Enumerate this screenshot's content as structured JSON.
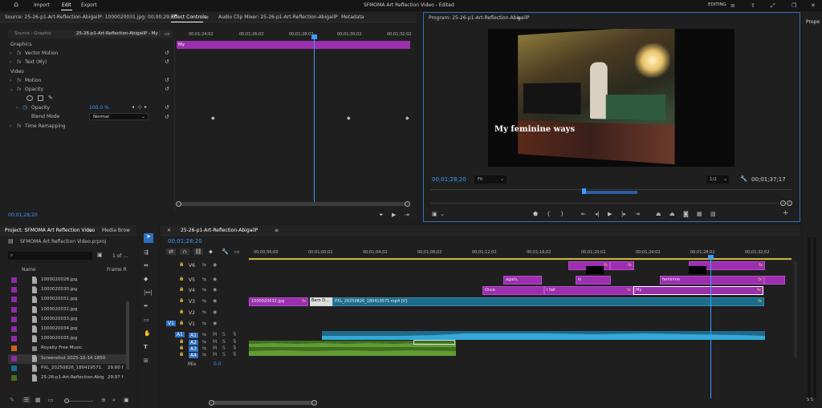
{
  "topbar": {
    "home": "home-icon",
    "menu": [
      "Import",
      "Edit",
      "Export"
    ],
    "active_menu": "Edit",
    "title": "SFMOMA Art Reflection Video - Edited",
    "workspace": "EDITING"
  },
  "source_panel": {
    "tabs": [
      "Source: 25-26-p1-Art-Reflection-AbigailP: 1000020031.jpg: 00;00;29;30",
      "Effect Controls",
      "Audio Clip Mixer: 25-26-p1-Art-Reflection-AbigailP",
      "Metadata"
    ],
    "active_tab": "Effect Controls"
  },
  "effect_controls": {
    "source_label": "Source - Graphic",
    "clip_label": "25-26-p1-Art-Reflection-AbigailP - My",
    "ruler": [
      "00;01;24;02",
      "00;01;26;02",
      "00;01;28;02",
      "00;01;30;02",
      "00;01;32;02"
    ],
    "clip_bar_label": "My",
    "rows": [
      {
        "label": "Graphics",
        "type": "section"
      },
      {
        "label": "Vector Motion",
        "type": "fx"
      },
      {
        "label": "Text (My)",
        "type": "fx"
      },
      {
        "label": "Video",
        "type": "section"
      },
      {
        "label": "Motion",
        "type": "fx"
      },
      {
        "label": "Opacity",
        "type": "fx"
      }
    ],
    "opacity_label": "Opacity",
    "opacity_value": "100.0 %",
    "blend_label": "Blend Mode",
    "blend_value": "Normal",
    "time_remap": "Time Remapping",
    "timecode": "00;01;28;20"
  },
  "program": {
    "title": "Program: 25-26-p1-Art-Reflection-AbigailP",
    "caption": "My feminine ways",
    "timecode": "00;01;28;20",
    "fit": "Fit",
    "resolution": "1/2",
    "duration": "00;01;37;17"
  },
  "properties": {
    "title": "Prope"
  },
  "project": {
    "tabs": [
      "Project: SFMOMA Art Reflection Video",
      "Media Brow"
    ],
    "path": "SFMOMA Art Reflection Video.prproj",
    "page": "1 of ...",
    "col_name": "Name",
    "col_rate": "Frame R",
    "items": [
      {
        "name": "1000020028.jpg",
        "color": "#8e2aa8",
        "rate": ""
      },
      {
        "name": "1000020030.jpg",
        "color": "#8e2aa8",
        "rate": ""
      },
      {
        "name": "1000020031.jpg",
        "color": "#8e2aa8",
        "rate": ""
      },
      {
        "name": "1000020032.jpg",
        "color": "#8e2aa8",
        "rate": ""
      },
      {
        "name": "1000020033.jpg",
        "color": "#8e2aa8",
        "rate": ""
      },
      {
        "name": "1000020034.jpg",
        "color": "#8e2aa8",
        "rate": ""
      },
      {
        "name": "1000020035.jpg",
        "color": "#8e2aa8",
        "rate": ""
      },
      {
        "name": "Royalty Free Music",
        "color": "#c9631e",
        "rate": ""
      },
      {
        "name": "Screenshot 2025-10-14 1850",
        "color": "#8e2aa8",
        "rate": ""
      },
      {
        "name": "PXL_20250826_180419571.",
        "color": "#1a6f8f",
        "rate": "29.60 f"
      },
      {
        "name": "25-26-p1-Art-Reflection-Abig",
        "color": "#4a6a1d",
        "rate": "29.97 f"
      }
    ]
  },
  "timeline": {
    "title": "25-26-p1-Art-Reflection-AbigailP",
    "timecode": "00;01;28;20",
    "ruler": [
      "00;00;56;00",
      "00;01;00;02",
      "00;01;04;02",
      "00;01;08;02",
      "00;01;12;02",
      "00;01;16;02",
      "00;01;20;02",
      "00;01;24;02",
      "00;01;28;02",
      "00;01;32;02"
    ],
    "tracks": [
      "V6",
      "V5",
      "V4",
      "V3",
      "V2",
      "V1",
      "A1",
      "A2",
      "A3",
      "A4"
    ],
    "src_v": "V1",
    "src_a": "A1",
    "mix_label": "Mix",
    "mix_value": "0.0",
    "clips": {
      "v6_a": "fx",
      "v5_again": "again,",
      "v5_in": "in",
      "v5_feminine": "feminine",
      "v4_once": "Once",
      "v4_ifall": "I fall",
      "v4_my": "My",
      "v3_a": "1000020032.jpg",
      "v3_b": "Barn D...",
      "v3_c": "PXL_20250826_180419571.mp4 [V]",
      "fx": "fx"
    }
  },
  "colors": {
    "accent": "#3d9bff",
    "clip_purple": "#9b2fae",
    "clip_teal": "#1d6d8a",
    "audio_green": "#4f8a27",
    "audio_blue": "#2f97c4",
    "playhead": "#3d9bff"
  }
}
